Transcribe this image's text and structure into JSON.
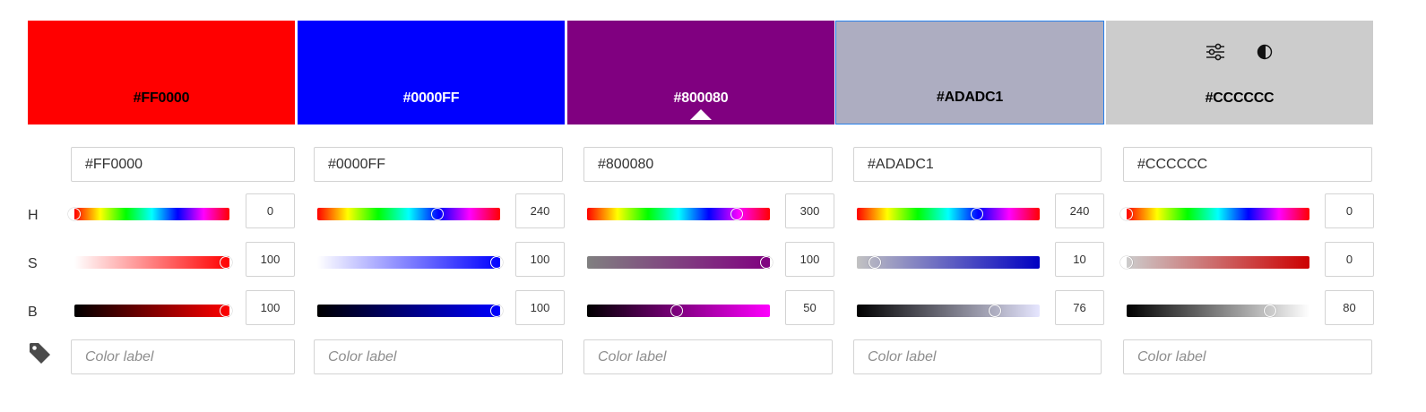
{
  "row_labels": {
    "h": "H",
    "s": "S",
    "b": "B"
  },
  "tag_icon": "tag-icon",
  "tool_icons": [
    "sliders-icon",
    "contrast-icon"
  ],
  "label_placeholder": "Color label",
  "colors": [
    {
      "hex": "#FF0000",
      "h": 0,
      "s": 100,
      "b": 100,
      "fill": "#FF0000",
      "text_color": "#000000",
      "selected": false,
      "active": false
    },
    {
      "hex": "#0000FF",
      "h": 240,
      "s": 100,
      "b": 100,
      "fill": "#0000FF",
      "text_color": "#FFFFFF",
      "selected": false,
      "active": false
    },
    {
      "hex": "#800080",
      "h": 300,
      "s": 100,
      "b": 50,
      "fill": "#800080",
      "text_color": "#FFFFFF",
      "selected": false,
      "active": true
    },
    {
      "hex": "#ADADC1",
      "h": 240,
      "s": 10,
      "b": 76,
      "fill": "#ADADC1",
      "text_color": "#000000",
      "selected": true,
      "active": false
    },
    {
      "hex": "#CCCCCC",
      "h": 0,
      "s": 0,
      "b": 80,
      "fill": "#CCCCCC",
      "text_color": "#000000",
      "selected": false,
      "active": false
    }
  ]
}
